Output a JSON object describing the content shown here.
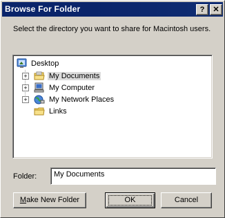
{
  "dialog": {
    "title": "Browse For Folder",
    "help_button": "?",
    "close_button": "✕",
    "prompt": "Select the directory you want to share for Macintosh users."
  },
  "tree": {
    "root": {
      "label": "Desktop",
      "icon": "desktop-icon"
    },
    "items": [
      {
        "label": "My Documents",
        "icon": "documents-folder-icon",
        "expandable": true,
        "selected": true
      },
      {
        "label": "My Computer",
        "icon": "computer-icon",
        "expandable": true
      },
      {
        "label": "My Network Places",
        "icon": "network-places-icon",
        "expandable": true
      },
      {
        "label": "Links",
        "icon": "folder-icon",
        "expandable": false
      }
    ]
  },
  "folder": {
    "label": "Folder:",
    "value": "My Documents"
  },
  "buttons": {
    "make_new_folder_first": "M",
    "make_new_folder_rest": "ake New Folder",
    "ok": "OK",
    "cancel": "Cancel"
  },
  "colors": {
    "titlebar": "#0a246a",
    "face": "#d4d0c8",
    "selection": "#dcdcdc"
  }
}
